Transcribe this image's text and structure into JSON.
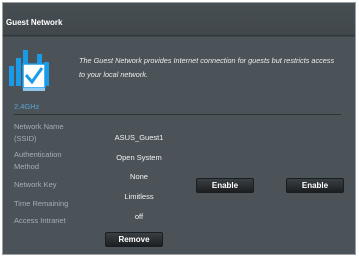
{
  "header": {
    "title": "Guest Network"
  },
  "description": "The Guest Network provides Internet connection for guests but restricts access to your local network.",
  "icon": "guest-network-icon",
  "band": "2.4GHz",
  "labels": {
    "network_name_line1": "Network Name",
    "network_name_line2": "(SSID)",
    "auth_line1": "Authentication",
    "auth_line2": "Method",
    "network_key": "Network Key",
    "time_remaining": "Time Remaining",
    "access_intranet": "Access Intranet"
  },
  "values": {
    "ssid": "ASUS_Guest1",
    "auth_method": "Open System",
    "network_key": "None",
    "time_remaining": "Limitless",
    "access_intranet": "off"
  },
  "buttons": {
    "remove": "Remove",
    "enable_1": "Enable",
    "enable_2": "Enable"
  },
  "colors": {
    "panel": "#4c5358",
    "band": "#5aa3d6",
    "icon_blue": "#1a9be8"
  }
}
